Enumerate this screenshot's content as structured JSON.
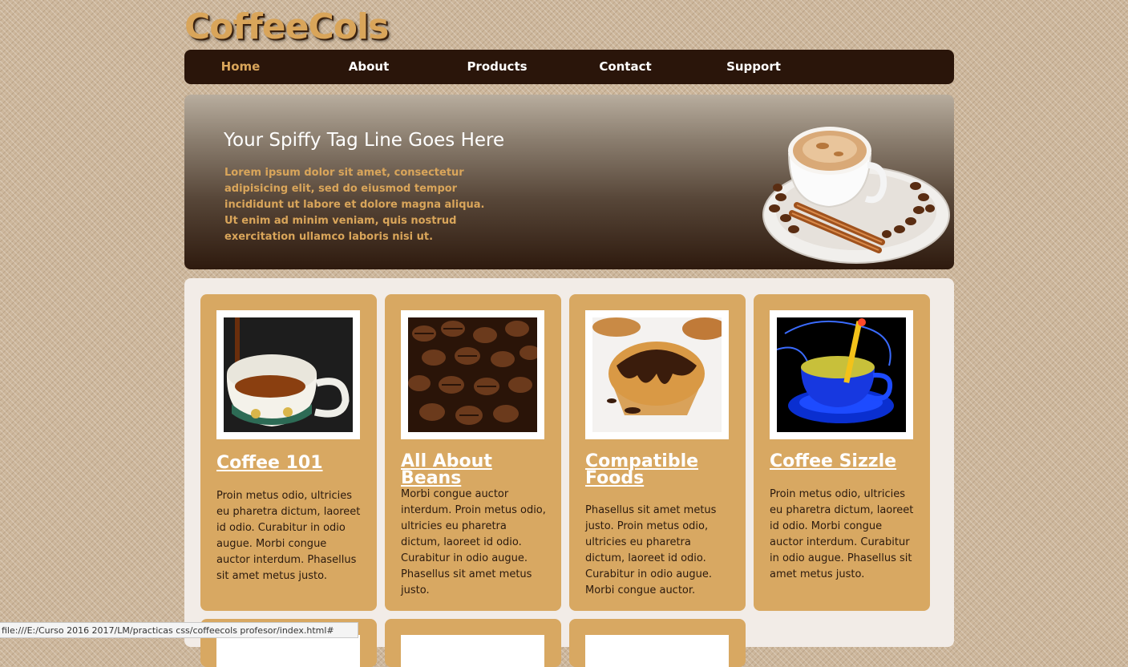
{
  "site": {
    "logo": "CoffeeCols"
  },
  "nav": {
    "items": [
      {
        "label": "Home",
        "active": true
      },
      {
        "label": "About",
        "active": false
      },
      {
        "label": "Products",
        "active": false
      },
      {
        "label": "Contact",
        "active": false
      },
      {
        "label": "Support",
        "active": false
      }
    ]
  },
  "hero": {
    "tagline": "Your Spiffy Tag Line Goes Here",
    "text": "Lorem ipsum dolor sit amet, consectetur adipisicing elit, sed do eiusmod tempor incididunt ut labore et dolore magna aliqua. Ut enim ad minim veniam, quis nostrud exercitation ullamco laboris nisi ut."
  },
  "cards": [
    {
      "title": "Coffee 101",
      "text": "Proin metus odio, ultricies eu pharetra dictum, laoreet id odio. Curabitur in odio augue. Morbi congue auctor interdum. Phasellus sit amet metus justo."
    },
    {
      "title": "All About Beans",
      "text": "Morbi congue auctor interdum. Proin metus odio, ultricies eu pharetra dictum, laoreet id odio. Curabitur in odio augue. Phasellus sit amet metus justo."
    },
    {
      "title": "Compatible Foods",
      "text": "Phasellus sit amet metus justo. Proin metus odio, ultricies eu pharetra dictum, laoreet id odio. Curabitur in odio augue. Morbi congue auctor."
    },
    {
      "title": "Coffee Sizzle",
      "text": "Proin metus odio, ultricies eu pharetra dictum, laoreet id odio. Morbi congue auctor interdum. Curabitur in odio augue. Phasellus sit amet metus justo."
    }
  ],
  "status": {
    "url": "file:///E:/Curso 2016 2017/LM/practicas css/coffeecols profesor/index.html#"
  },
  "colors": {
    "accent": "#d9a55a",
    "nav_bg": "#2a150a",
    "card_bg": "#d8a862",
    "content_bg": "#f2ece7"
  }
}
